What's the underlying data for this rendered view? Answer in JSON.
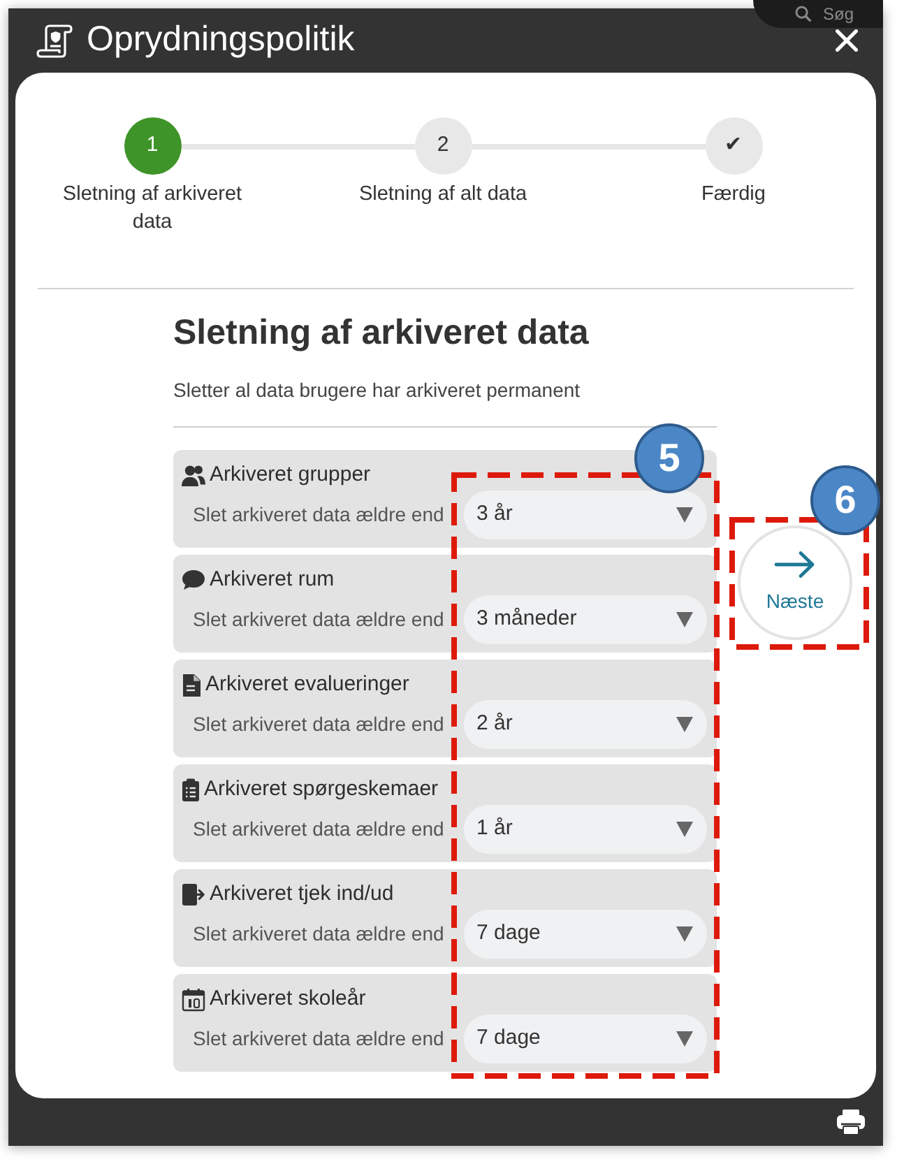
{
  "window": {
    "title": "Oprydningspolitik"
  },
  "search": {
    "placeholder": "Søg"
  },
  "steps": [
    {
      "marker": "1",
      "label": "Sletning af arkiveret data",
      "selected": true
    },
    {
      "marker": "2",
      "label": "Sletning af alt data",
      "selected": false
    },
    {
      "marker": "✔",
      "label": "Færdig",
      "selected": false
    }
  ],
  "section": {
    "title": "Sletning af arkiveret data",
    "description": "Sletter al data brugere har arkiveret permanent"
  },
  "rules": [
    {
      "kind": "groups",
      "title": "Arkiveret grupper",
      "label": "Slet arkiveret data ældre end",
      "value": "3 år"
    },
    {
      "kind": "rooms",
      "title": "Arkiveret rum",
      "label": "Slet arkiveret data ældre end",
      "value": "3 måneder"
    },
    {
      "kind": "evaluations",
      "title": "Arkiveret evalueringer",
      "label": "Slet arkiveret data ældre end",
      "value": "2 år"
    },
    {
      "kind": "surveys",
      "title": "Arkiveret spørgeskemaer",
      "label": "Slet arkiveret data ældre end",
      "value": "1 år"
    },
    {
      "kind": "checkins",
      "title": "Arkiveret tjek ind/ud",
      "label": "Slet arkiveret data ældre end",
      "value": "7 dage"
    },
    {
      "kind": "schoolyears",
      "title": "Arkiveret skoleår",
      "label": "Slet arkiveret data ældre end",
      "value": "7 dage"
    }
  ],
  "next_button": {
    "label": "Næste"
  },
  "callouts": [
    {
      "kind": "dropdowns",
      "number": "5"
    },
    {
      "kind": "next",
      "number": "6"
    }
  ]
}
